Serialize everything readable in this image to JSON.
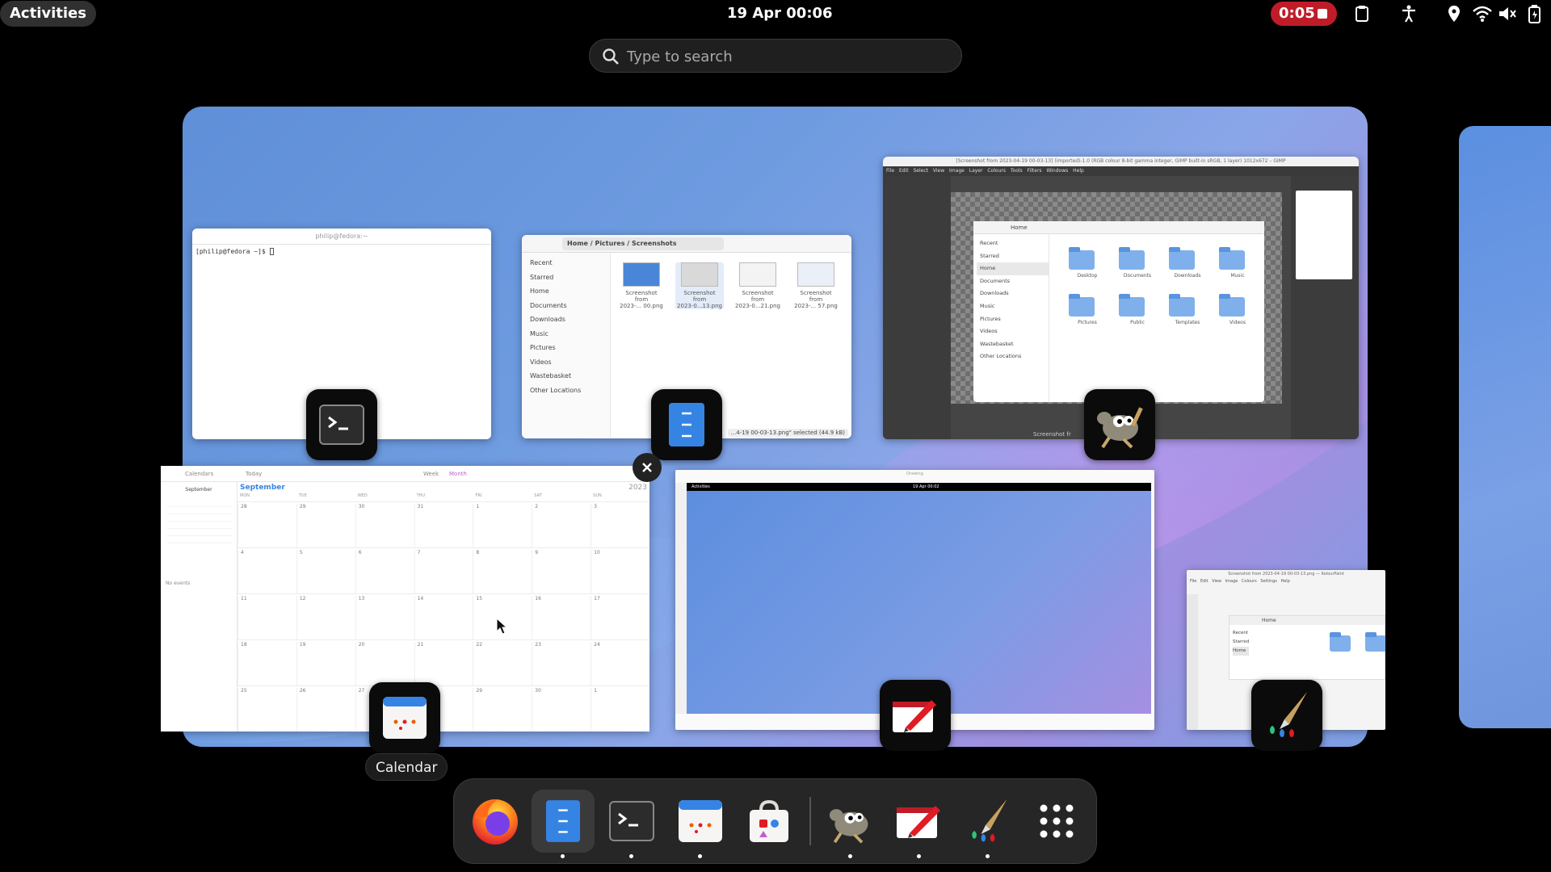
{
  "topbar": {
    "activities": "Activities",
    "datetime": "19 Apr  00:06",
    "recording_time": "0:05"
  },
  "search": {
    "placeholder": "Type to search"
  },
  "windows": {
    "terminal": {
      "title": "philip@fedora:~",
      "prompt": "[philip@fedora ~]$ "
    },
    "files": {
      "breadcrumbs": [
        "Home",
        "Pictures",
        "Screenshots"
      ],
      "sidebar": [
        "Recent",
        "Starred",
        "Home",
        "Documents",
        "Downloads",
        "Music",
        "Pictures",
        "Videos",
        "Wastebasket",
        "Other Locations"
      ],
      "thumbnails": [
        {
          "line1": "Screenshot",
          "line2": "from",
          "line3": "2023-... 00.png"
        },
        {
          "line1": "Screenshot",
          "line2": "from",
          "line3": "2023-0...13.png"
        },
        {
          "line1": "Screenshot",
          "line2": "from",
          "line3": "2023-0...21.png"
        },
        {
          "line1": "Screenshot",
          "line2": "from",
          "line3": "2023-... 57.png"
        }
      ],
      "status": "...4-19 00-03-13.png\" selected (44.9 kB)"
    },
    "gimp": {
      "title": "[Screenshot from 2023-04-19 00-03-13] (imported)-1.0 (RGB colour 8-bit gamma integer, GIMP built-in sRGB, 1 layer) 1012x672 – GIMP",
      "menu": "File Edit Select View Image Layer Colours Tools Filters Windows Help",
      "inner_location": "Home",
      "inner_sidebar": [
        "Recent",
        "Starred",
        "Home",
        "Documents",
        "Downloads",
        "Music",
        "Pictures",
        "Videos",
        "Wastebasket",
        "Other Locations"
      ],
      "inner_folders": [
        "Desktop",
        "Documents",
        "Downloads",
        "Music",
        "Pictures",
        "Public",
        "Templates",
        "Videos"
      ],
      "status": "Screenshot fr"
    },
    "calendar": {
      "sidebar_title": "Calendars",
      "today": "Today",
      "mini_month": "September",
      "month": "September",
      "year": "2023",
      "view_week": "Week",
      "view_month": "Month",
      "no_events": "No events",
      "weekdays": [
        "MON",
        "TUE",
        "WED",
        "THU",
        "FRI",
        "SAT",
        "SUN"
      ],
      "week_rows": [
        [
          "28",
          "29",
          "30",
          "31",
          "1",
          "2",
          "3"
        ],
        [
          "4",
          "5",
          "6",
          "7",
          "8",
          "9",
          "10"
        ],
        [
          "11",
          "12",
          "13",
          "14",
          "15",
          "16",
          "17"
        ],
        [
          "18",
          "19",
          "20",
          "21",
          "22",
          "23",
          "24"
        ],
        [
          "25",
          "26",
          "27",
          "28",
          "29",
          "30",
          "1"
        ]
      ]
    },
    "drawing": {
      "title": "Drawing",
      "inner_activities": "Activities",
      "inner_clock": "19 Apr  00:02"
    },
    "kolourpaint": {
      "title": "Screenshot from 2023-04-19 00-03-13.png — KolourPaint",
      "menu": "File Edit View Image Colours Settings Help",
      "sidebar": [
        "Recent",
        "Starred",
        "Home"
      ],
      "location": "Home"
    }
  },
  "tooltip": "Calendar",
  "dock": {
    "items": [
      "firefox-icon",
      "files-icon",
      "terminal-icon",
      "calendar-icon",
      "software-icon",
      "gimp-icon",
      "drawing-icon",
      "kolourpaint-icon",
      "app-grid-icon"
    ]
  },
  "colors": {
    "accent_red": "#c01c28",
    "files_blue": "#3584e4"
  }
}
